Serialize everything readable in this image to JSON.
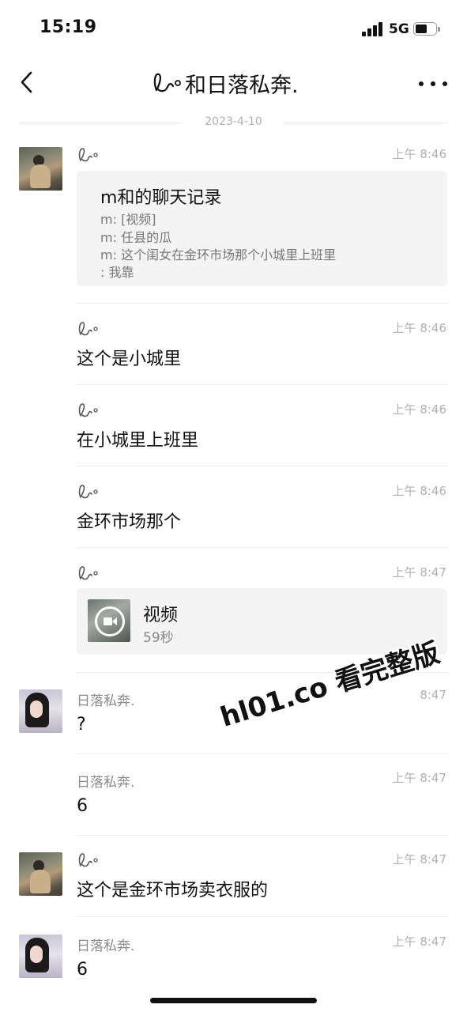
{
  "status": {
    "time": "15:19",
    "network": "5G"
  },
  "chat": {
    "title": "和日落私奔.",
    "date": "2023-4-10"
  },
  "messages": [
    {
      "sender": "",
      "avatar": "photo-avatar",
      "time": "上午 8:46",
      "type": "record",
      "record": {
        "title": "m和的聊天记录",
        "lines": [
          "m: [视频]",
          "m: 任县的瓜",
          "m: 这个闺女在金环市场那个小城里上班里",
          ": 我靠"
        ]
      }
    },
    {
      "sender": "",
      "time": "上午 8:46",
      "type": "text",
      "text": "这个是小城里"
    },
    {
      "sender": "",
      "time": "上午 8:46",
      "type": "text",
      "text": "在小城里上班里"
    },
    {
      "sender": "",
      "time": "上午 8:46",
      "type": "text",
      "text": "金环市场那个"
    },
    {
      "sender": "",
      "time": "上午 8:47",
      "type": "video",
      "video": {
        "title": "视频",
        "duration": "59秒"
      }
    },
    {
      "sender": "日落私奔.",
      "avatar": "girl-avatar",
      "time": "8:47",
      "type": "text",
      "text": "?"
    },
    {
      "sender": "日落私奔.",
      "time": "上午 8:47",
      "type": "text",
      "text": "6"
    },
    {
      "sender": "",
      "avatar": "photo-avatar",
      "time": "上午 8:47",
      "type": "text",
      "text": "这个是金环市场卖衣服的"
    },
    {
      "sender": "日落私奔.",
      "avatar": "girl-avatar",
      "time": "上午 8:47",
      "type": "text",
      "text": "6"
    }
  ],
  "watermark": "hl01.co 看完整版",
  "colors": {
    "background": "#ffffff",
    "card": "#f4f4f4",
    "meta": "#b0b0b0"
  }
}
